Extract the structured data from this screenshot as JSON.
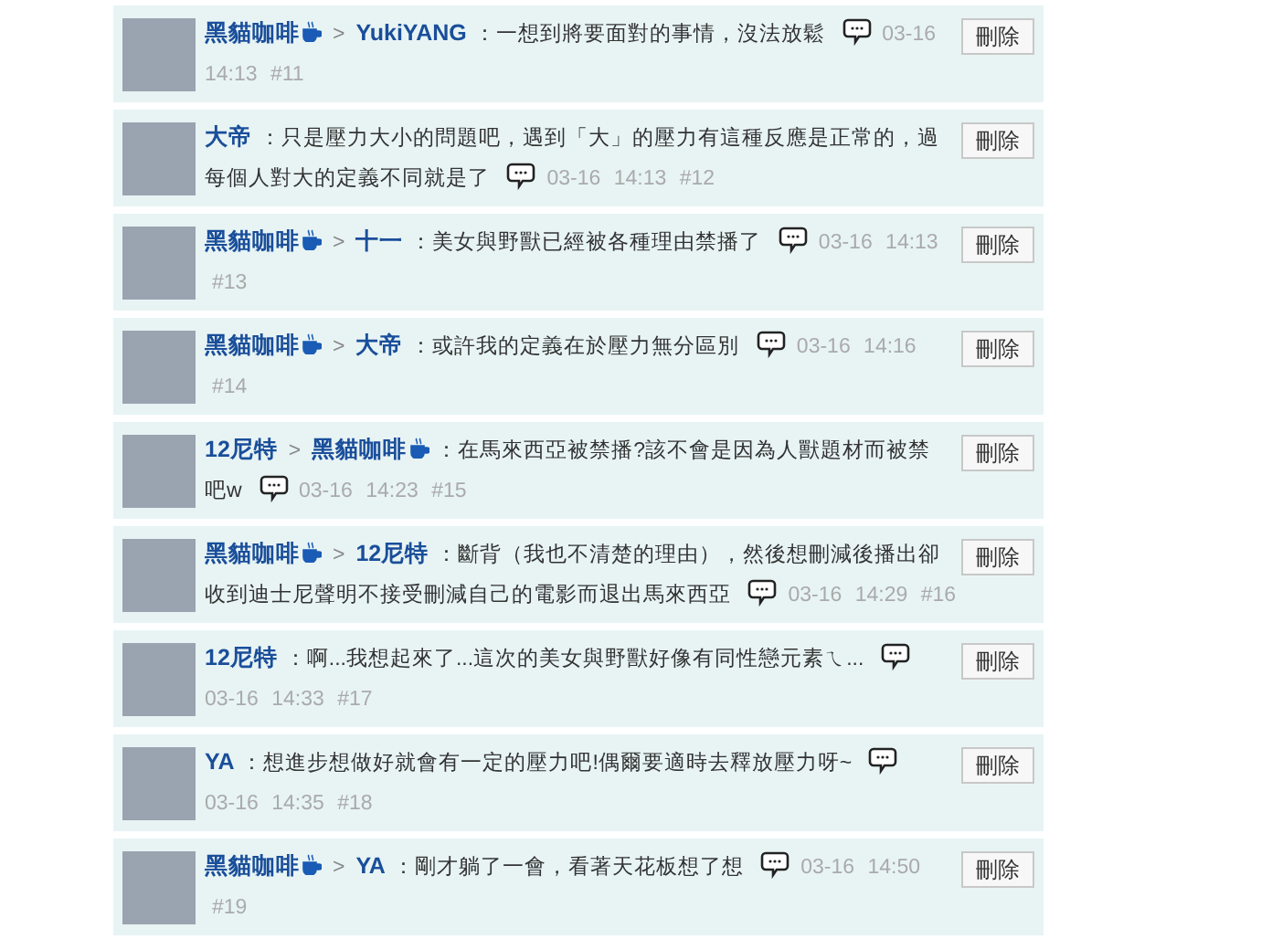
{
  "comments": [
    {
      "author": {
        "name": "黑貓咖啡",
        "cup_badge": true
      },
      "reply_to": {
        "name": "YukiYANG",
        "cup_badge": false
      },
      "separator": ">",
      "text_lines": [
        "：一想到將要面對的事情，沒法放鬆"
      ],
      "date": "03-16",
      "clock": "14:13",
      "floor": "#11",
      "delete_label": "刪除"
    },
    {
      "author": {
        "name": "大帝",
        "cup_badge": false
      },
      "text_lines": [
        "：只是壓力大小的問題吧，遇到「大」的壓力有這種反應是正常的，過",
        "每個人對大的定義不同就是了"
      ],
      "date": "03-16",
      "clock": "14:13",
      "floor": "#12",
      "delete_label": "刪除"
    },
    {
      "author": {
        "name": "黑貓咖啡",
        "cup_badge": true
      },
      "reply_to": {
        "name": "十一",
        "cup_badge": false
      },
      "separator": ">",
      "text_lines": [
        "：美女與野獸已經被各種理由禁播了"
      ],
      "date": "03-16",
      "clock": "14:13",
      "floor": "#13",
      "delete_label": "刪除"
    },
    {
      "author": {
        "name": "黑貓咖啡",
        "cup_badge": true
      },
      "reply_to": {
        "name": "大帝",
        "cup_badge": false
      },
      "separator": ">",
      "text_lines": [
        "：或許我的定義在於壓力無分區別"
      ],
      "date": "03-16",
      "clock": "14:16",
      "floor": "#14",
      "delete_label": "刪除"
    },
    {
      "author": {
        "name": "12尼特",
        "cup_badge": false
      },
      "reply_to": {
        "name": "黑貓咖啡",
        "cup_badge": true
      },
      "separator": ">",
      "text_lines": [
        "：在馬來西亞被禁播?該不會是因為人獸題材而被禁",
        "吧w"
      ],
      "date": "03-16",
      "clock": "14:23",
      "floor": "#15",
      "delete_label": "刪除"
    },
    {
      "author": {
        "name": "黑貓咖啡",
        "cup_badge": true
      },
      "reply_to": {
        "name": "12尼特",
        "cup_badge": false
      },
      "separator": ">",
      "text_lines": [
        "：斷背（我也不清楚的理由），然後想刪減後播出卻",
        "收到迪士尼聲明不接受刪減自己的電影而退出馬來西亞"
      ],
      "date": "03-16",
      "clock": "14:29",
      "floor": "#16",
      "delete_label": "刪除"
    },
    {
      "author": {
        "name": "12尼特",
        "cup_badge": false
      },
      "text_lines": [
        "：啊...我想起來了...這次的美女與野獸好像有同性戀元素ㄟ..."
      ],
      "date": "03-16",
      "clock": "14:33",
      "floor": "#17",
      "delete_label": "刪除"
    },
    {
      "author": {
        "name": "YA",
        "cup_badge": false
      },
      "text_lines": [
        "：想進步想做好就會有一定的壓力吧!偶爾要適時去釋放壓力呀~"
      ],
      "date": "03-16",
      "clock": "14:35",
      "floor": "#18",
      "delete_label": "刪除"
    },
    {
      "author": {
        "name": "黑貓咖啡",
        "cup_badge": true
      },
      "reply_to": {
        "name": "YA",
        "cup_badge": false
      },
      "separator": ">",
      "text_lines": [
        "：剛才躺了一會，看著天花板想了想"
      ],
      "date": "03-16",
      "clock": "14:50",
      "floor": "#19",
      "delete_label": "刪除"
    }
  ]
}
